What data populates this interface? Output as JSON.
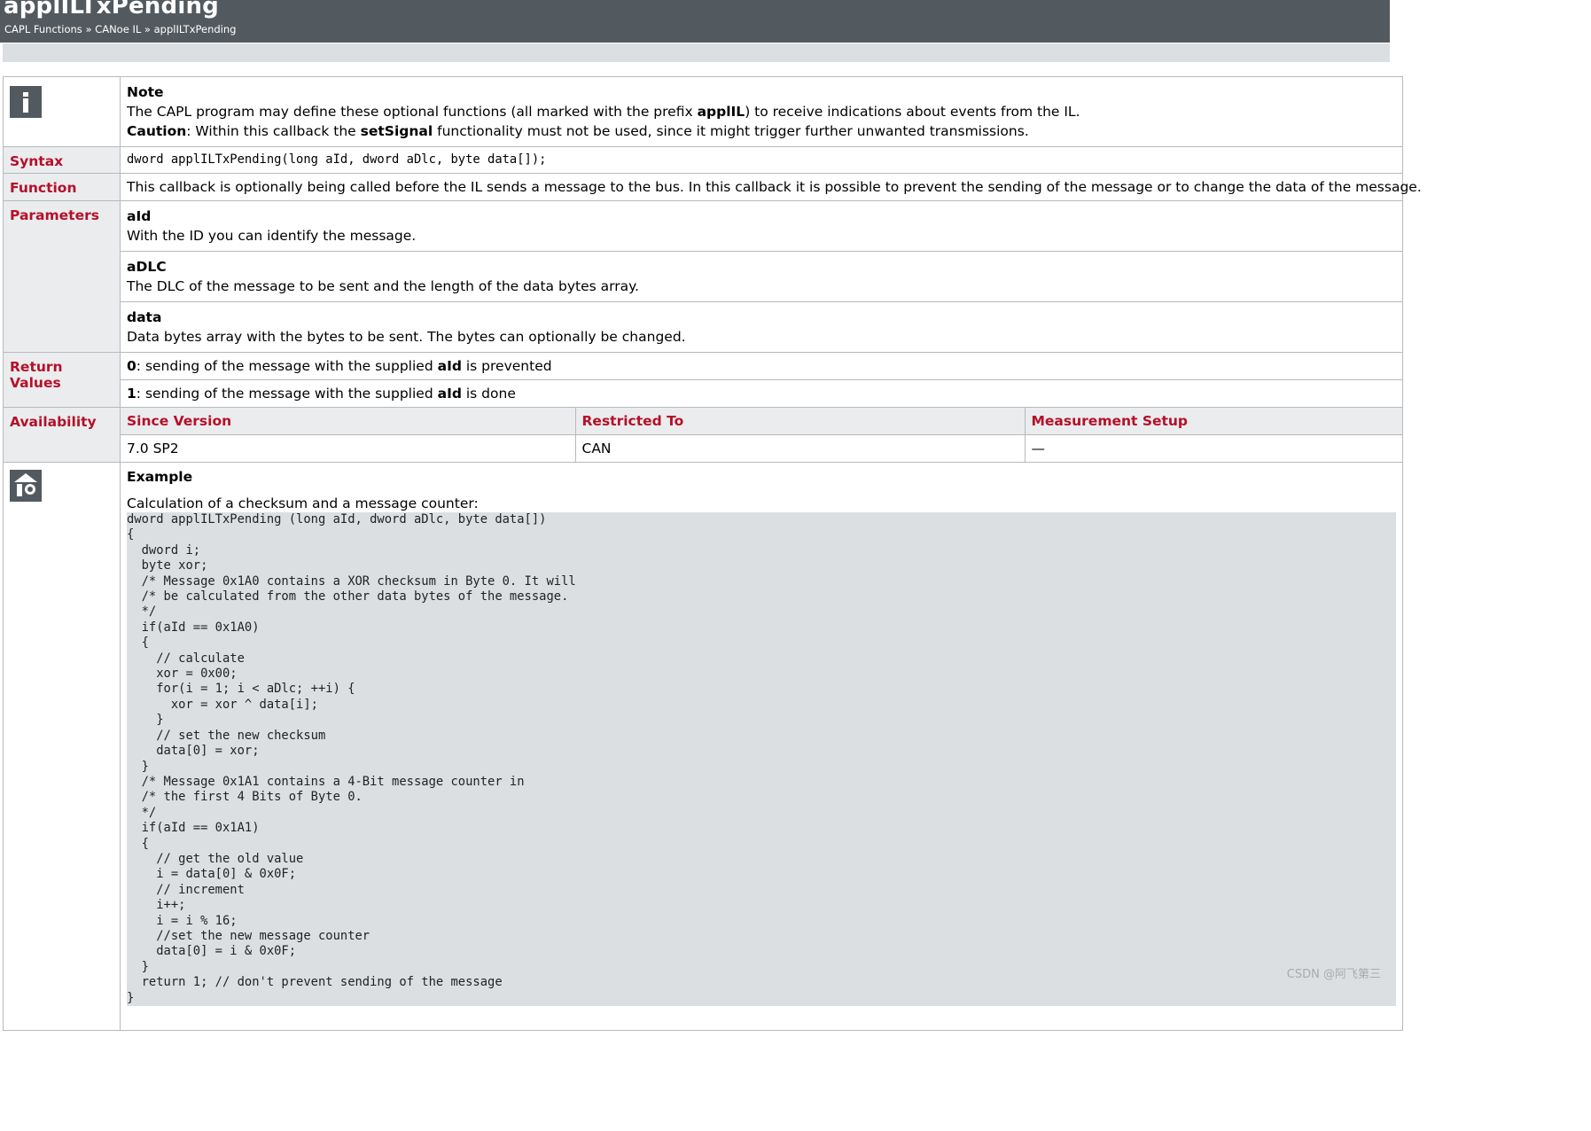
{
  "header": {
    "title": "applILTxPending",
    "breadcrumb": [
      "CAPL Functions",
      "CANoe IL",
      "applILTxPending"
    ],
    "separator": "»"
  },
  "note": {
    "heading": "Note",
    "text_pre": "The CAPL program may define these optional functions (all marked with the prefix ",
    "text_bold": "applIL",
    "text_post": ") to receive indications about events from the IL.",
    "caution_label": "Caution",
    "caution_pre": ": Within this callback the ",
    "caution_bold": "setSignal",
    "caution_post": " functionality must not be used, since it might trigger further unwanted transmissions."
  },
  "syntax": {
    "label": "Syntax",
    "code": "dword applILTxPending(long aId, dword aDlc, byte data[]);"
  },
  "function": {
    "label": "Function",
    "text": "This callback is optionally being called before the IL sends a message to the bus. In this callback it is possible to prevent the sending of the message or to change the data of the message."
  },
  "parameters": {
    "label": "Parameters",
    "items": [
      {
        "name": "aId",
        "desc": "With the ID you can identify the message."
      },
      {
        "name": "aDLC",
        "desc": "The DLC of the message to be sent and the length of the data bytes array."
      },
      {
        "name": "data",
        "desc": "Data bytes array with the bytes to be sent. The bytes can optionally be changed."
      }
    ]
  },
  "return_values": {
    "label": "Return Values",
    "items": [
      {
        "value": "0",
        "pre": ": sending of the message with the supplied ",
        "bold": "aId",
        "post": " is prevented"
      },
      {
        "value": "1",
        "pre": ": sending of the message with the supplied ",
        "bold": "aId",
        "post": " is done"
      }
    ]
  },
  "availability": {
    "label": "Availability",
    "columns": [
      "Since Version",
      "Restricted To",
      "Measurement Setup"
    ],
    "row": [
      "7.0 SP2",
      "CAN",
      "—"
    ]
  },
  "example": {
    "heading": "Example",
    "intro": "Calculation of a checksum and a message counter:",
    "code": "dword applILTxPending (long aId, dword aDlc, byte data[])\n{\n  dword i;\n  byte xor;\n  /* Message 0x1A0 contains a XOR checksum in Byte 0. It will\n  /* be calculated from the other data bytes of the message.\n  */\n  if(aId == 0x1A0)\n  {\n    // calculate\n    xor = 0x00;\n    for(i = 1; i < aDlc; ++i) {\n      xor = xor ^ data[i];\n    }\n    // set the new checksum\n    data[0] = xor;\n  }\n  /* Message 0x1A1 contains a 4-Bit message counter in\n  /* the first 4 Bits of Byte 0.\n  */\n  if(aId == 0x1A1)\n  {\n    // get the old value\n    i = data[0] & 0x0F;\n    // increment\n    i++;\n    i = i % 16;\n    //set the new message counter\n    data[0] = i & 0x0F;\n  }\n  return 1; // don't prevent sending of the message\n}"
  },
  "watermark": "CSDN @阿飞第三",
  "colors": {
    "header_bg": "#535a5f",
    "label_red": "#b51029",
    "label_bg": "#eaecee",
    "code_bg": "#dcdfe2"
  },
  "icons": {
    "note": "info-icon",
    "example": "example-icon"
  }
}
